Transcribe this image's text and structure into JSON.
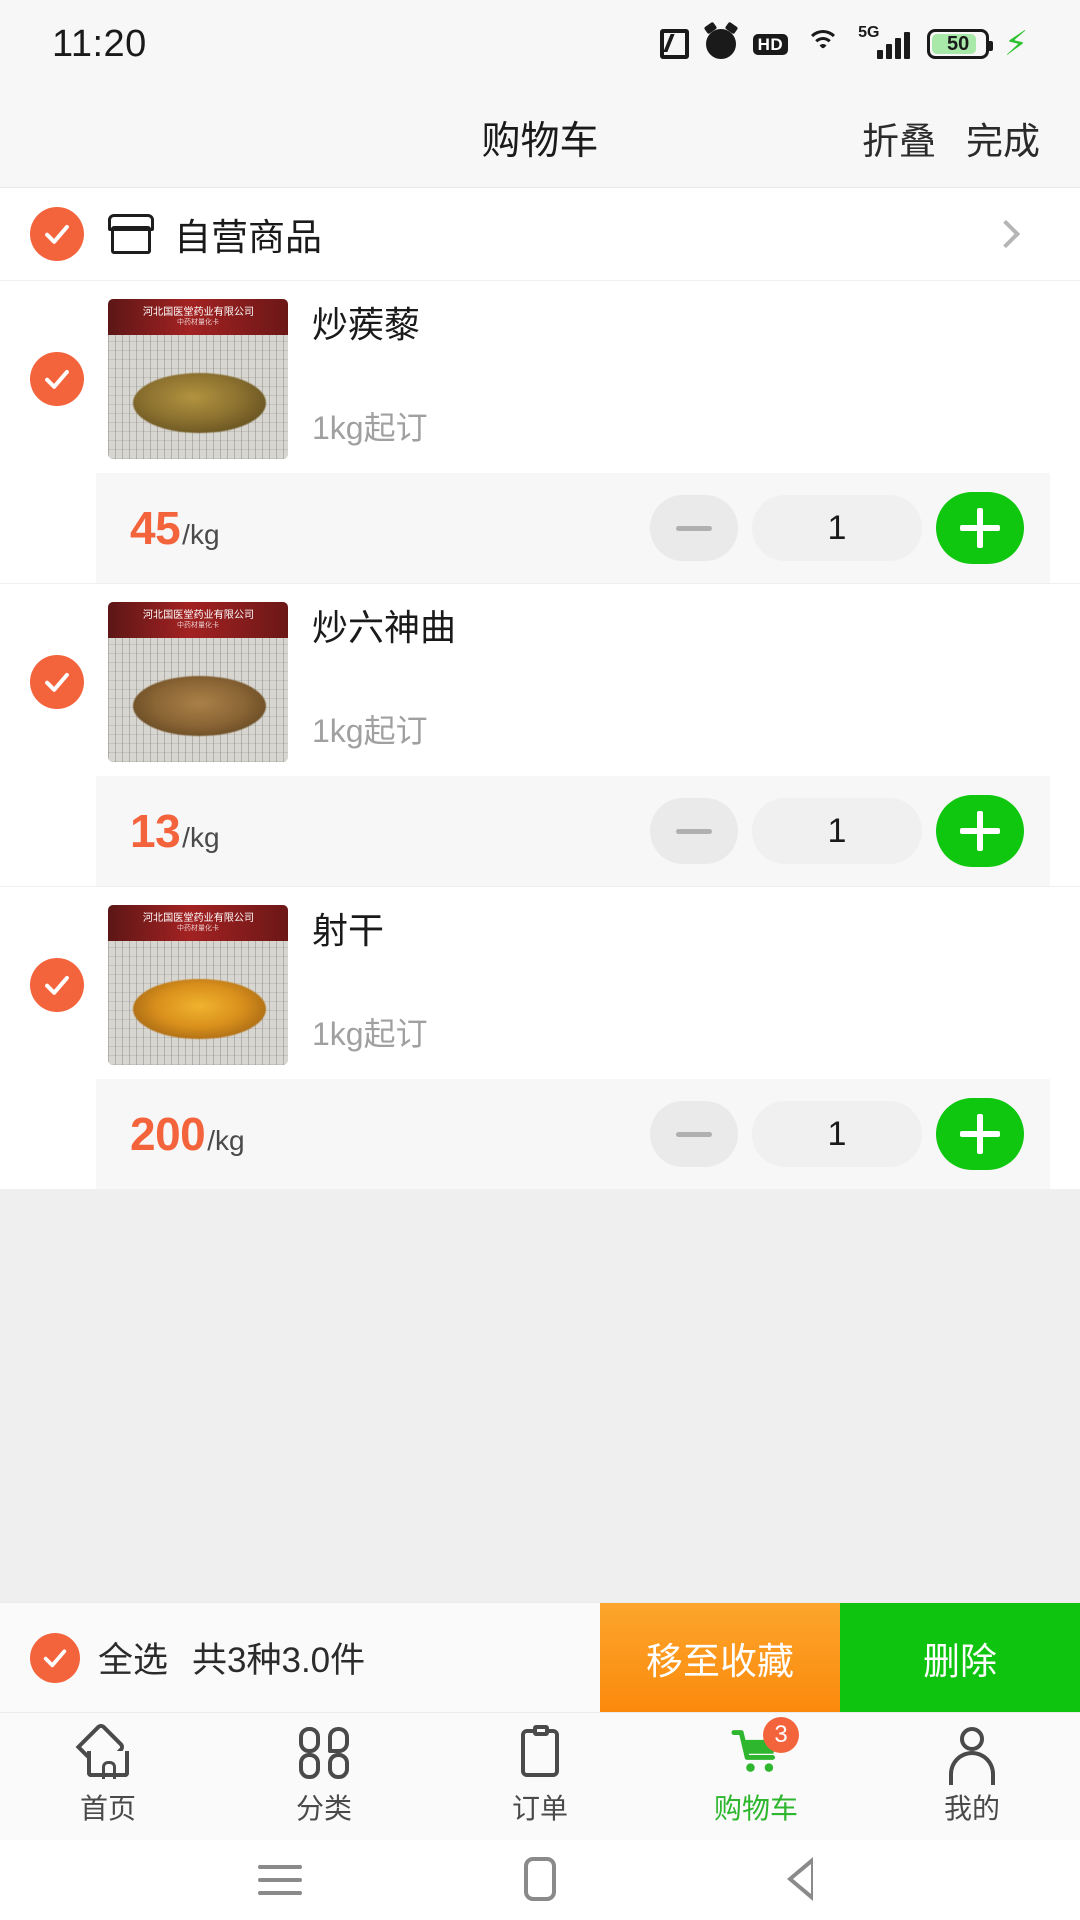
{
  "status_bar": {
    "time": "11:20",
    "battery_level": "50",
    "network": "5G",
    "hd_label": "HD",
    "icons": [
      "nfc-icon",
      "alarm-icon",
      "hd-icon",
      "wifi-icon",
      "signal-icon",
      "battery-icon",
      "charging-bolt-icon"
    ]
  },
  "header": {
    "title": "购物车",
    "collapse_label": "折叠",
    "done_label": "完成"
  },
  "store": {
    "name": "自营商品",
    "checked": true
  },
  "products": [
    {
      "name": "炒蒺藜",
      "moq": "1kg起订",
      "price": "45",
      "unit": "/kg",
      "qty": "1",
      "checked": true,
      "image_banner_line1": "河北国医堂药业有限公司",
      "image_banner_line2": "中药材量化卡",
      "pile_style": "seeds"
    },
    {
      "name": "炒六神曲",
      "moq": "1kg起订",
      "price": "13",
      "unit": "/kg",
      "qty": "1",
      "checked": true,
      "image_banner_line1": "河北国医堂药业有限公司",
      "image_banner_line2": "中药材量化卡",
      "pile_style": "granule"
    },
    {
      "name": "射干",
      "moq": "1kg起订",
      "price": "200",
      "unit": "/kg",
      "qty": "1",
      "checked": true,
      "image_banner_line1": "河北国医堂药业有限公司",
      "image_banner_line2": "中药材量化卡",
      "pile_style": "flakes"
    }
  ],
  "action_bar": {
    "select_all_label": "全选",
    "summary": "共3种3.0件",
    "move_to_favorites_label": "移至收藏",
    "delete_label": "删除"
  },
  "tab_bar": {
    "items": [
      {
        "label": "首页",
        "icon": "home-icon",
        "active": false
      },
      {
        "label": "分类",
        "icon": "grid-icon",
        "active": false
      },
      {
        "label": "订单",
        "icon": "clipboard-icon",
        "active": false
      },
      {
        "label": "购物车",
        "icon": "cart-icon",
        "active": true,
        "badge": "3"
      },
      {
        "label": "我的",
        "icon": "person-icon",
        "active": false
      }
    ]
  },
  "colors": {
    "accent_orange": "#f4643c",
    "green": "#0ec70e",
    "favorite_orange": "#fb8a0c"
  }
}
